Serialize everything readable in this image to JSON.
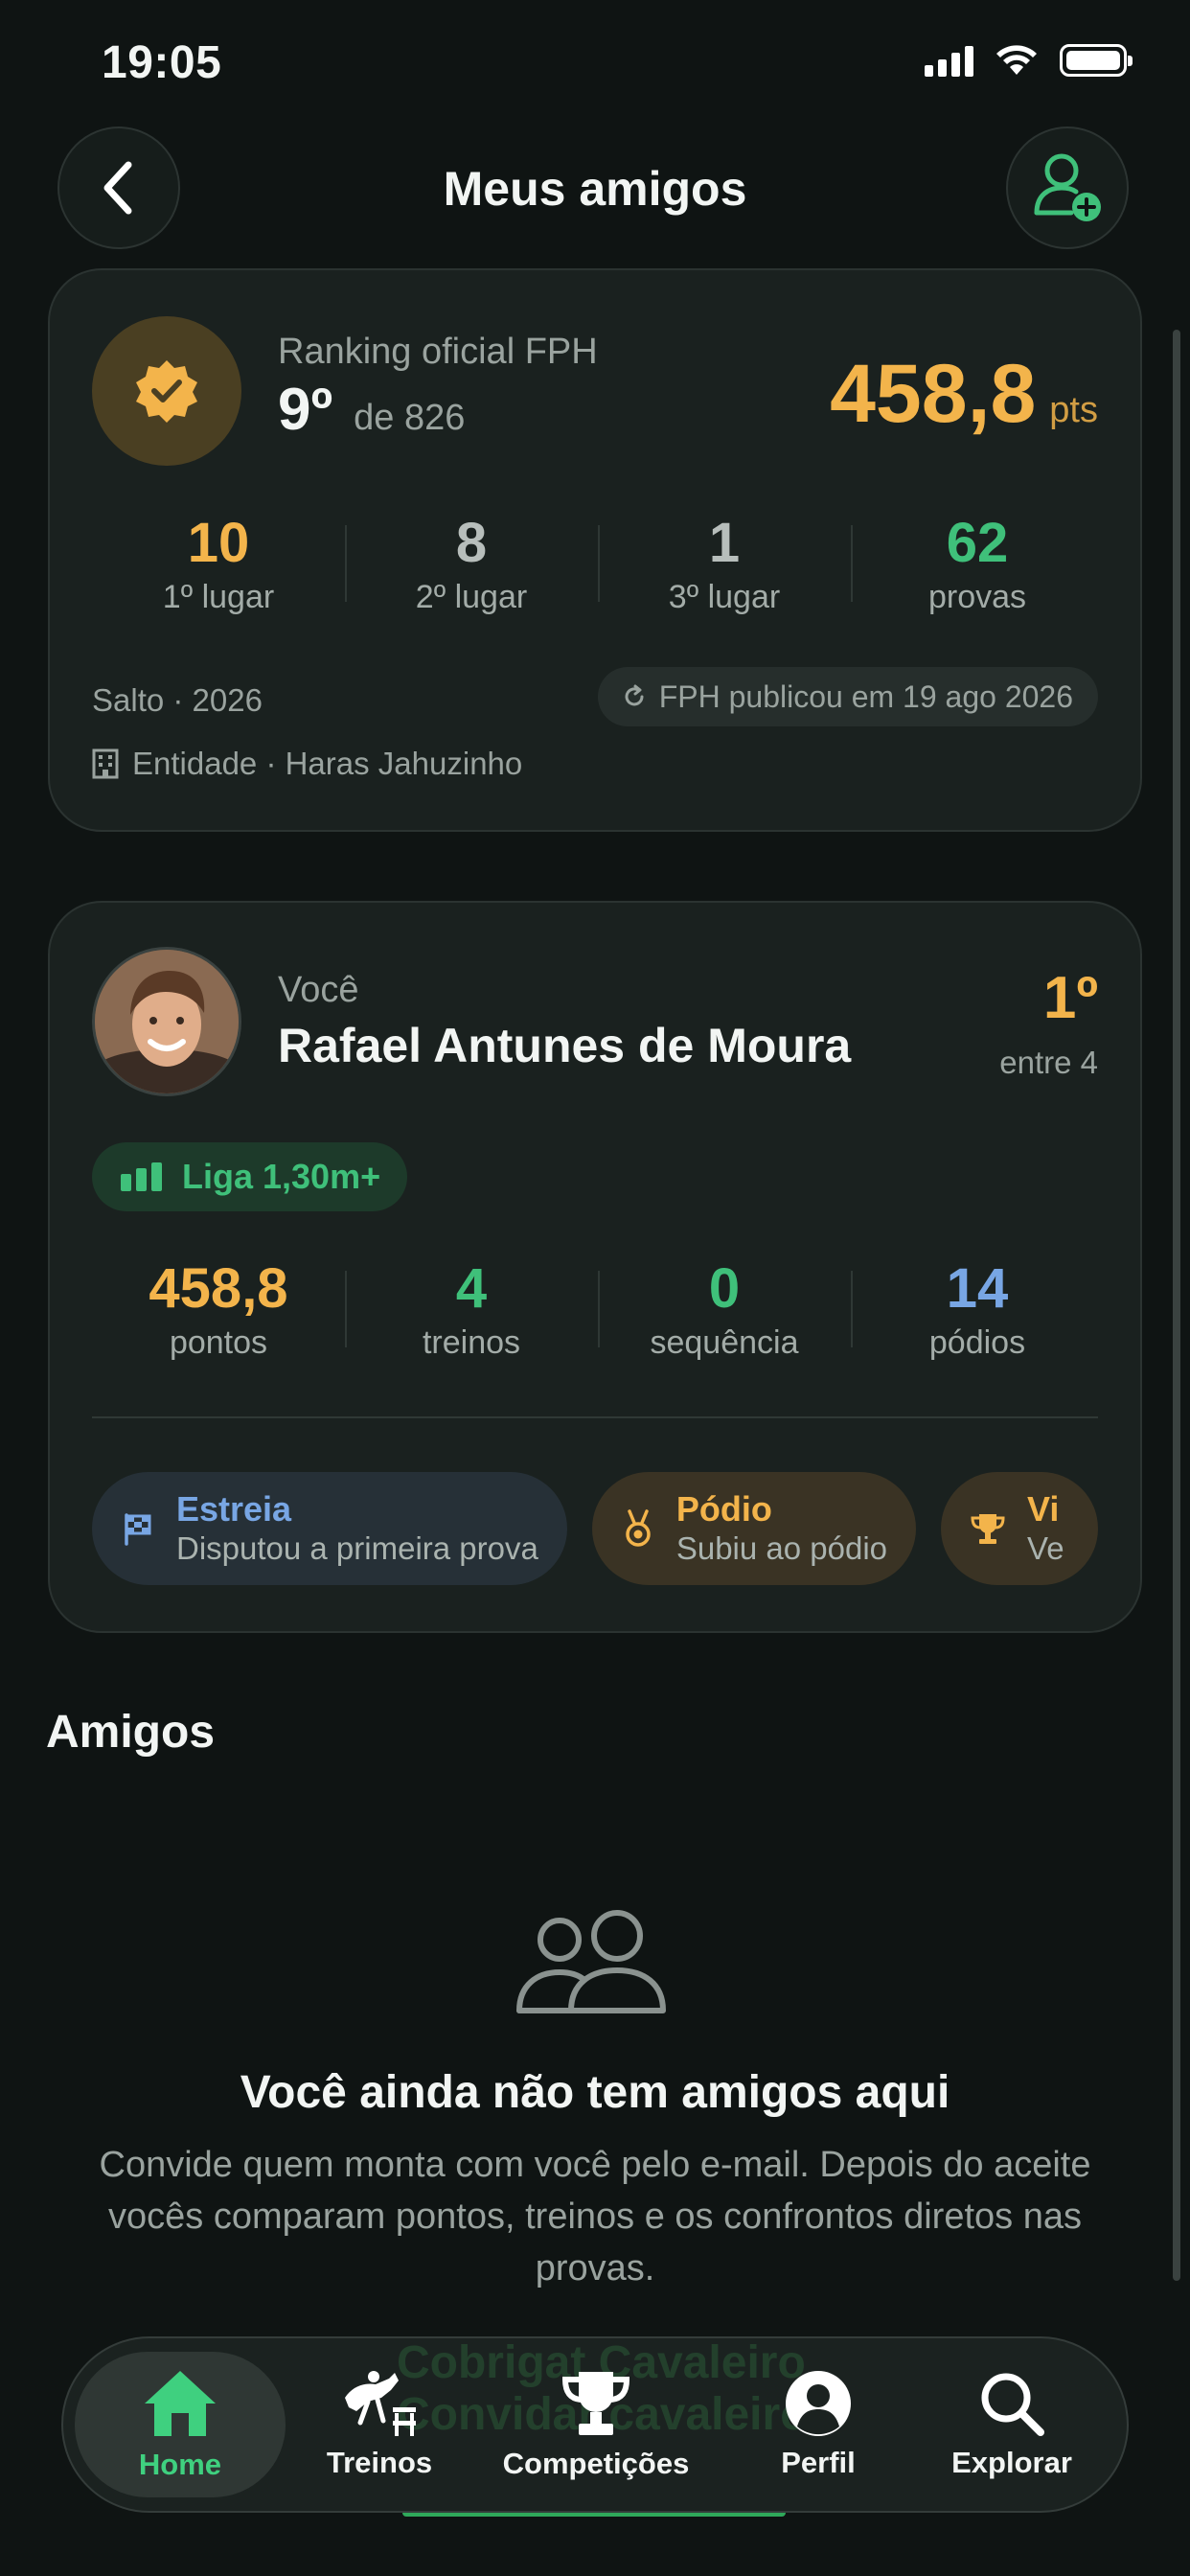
{
  "status_bar": {
    "time": "19:05"
  },
  "header": {
    "title": "Meus amigos"
  },
  "ranking": {
    "label": "Ranking oficial FPH",
    "position": "9º",
    "of_total": "de 826",
    "points": "458,8",
    "points_unit": "pts",
    "stats": [
      {
        "value": "10",
        "label": "1º lugar",
        "color": "#f3b44b"
      },
      {
        "value": "8",
        "label": "2º lugar",
        "color": "#b7bebb"
      },
      {
        "value": "1",
        "label": "3º lugar",
        "color": "#b7bebb"
      },
      {
        "value": "62",
        "label": "provas",
        "color": "#3fc07a"
      }
    ],
    "season": "Salto · 2026",
    "published": "FPH publicou em 19 ago 2026",
    "entity": "Entidade · Haras Jahuzinho"
  },
  "me": {
    "caption": "Você",
    "name": "Rafael Antunes de Moura",
    "rank": "1º",
    "rank_of": "entre 4",
    "league": "Liga 1,30m+",
    "stats": [
      {
        "value": "458,8",
        "label": "pontos",
        "color": "#f3b44b"
      },
      {
        "value": "4",
        "label": "treinos",
        "color": "#3fc07a"
      },
      {
        "value": "0",
        "label": "sequência",
        "color": "#3fc07a"
      },
      {
        "value": "14",
        "label": "pódios",
        "color": "#78a6e4"
      }
    ],
    "badges": [
      {
        "title": "Estreia",
        "desc": "Disputou a primeira prova",
        "icon": "checkered-flag-icon"
      },
      {
        "title": "Pódio",
        "desc": "Subiu ao pódio",
        "icon": "medal-icon"
      },
      {
        "title": "Vi",
        "desc": "Ve",
        "icon": "trophy-icon"
      }
    ]
  },
  "friends": {
    "section_title": "Amigos",
    "empty_title": "Você ainda não tem amigos aqui",
    "empty_desc": "Convide quem monta com você pelo e-mail. Depois do aceite vocês comparam pontos, treinos e os confrontos diretos nas provas.",
    "ghost_line1": "Cobrigat Cavaleiro",
    "ghost_line2": "Convidar cavaleiro"
  },
  "tabbar": {
    "items": [
      {
        "label": "Home",
        "icon": "home-icon",
        "active": true
      },
      {
        "label": "Treinos",
        "icon": "horse-jump-icon",
        "active": false
      },
      {
        "label": "Competições",
        "icon": "trophy-icon",
        "active": false
      },
      {
        "label": "Perfil",
        "icon": "user-icon",
        "active": false
      },
      {
        "label": "Explorar",
        "icon": "search-icon",
        "active": false
      }
    ]
  }
}
